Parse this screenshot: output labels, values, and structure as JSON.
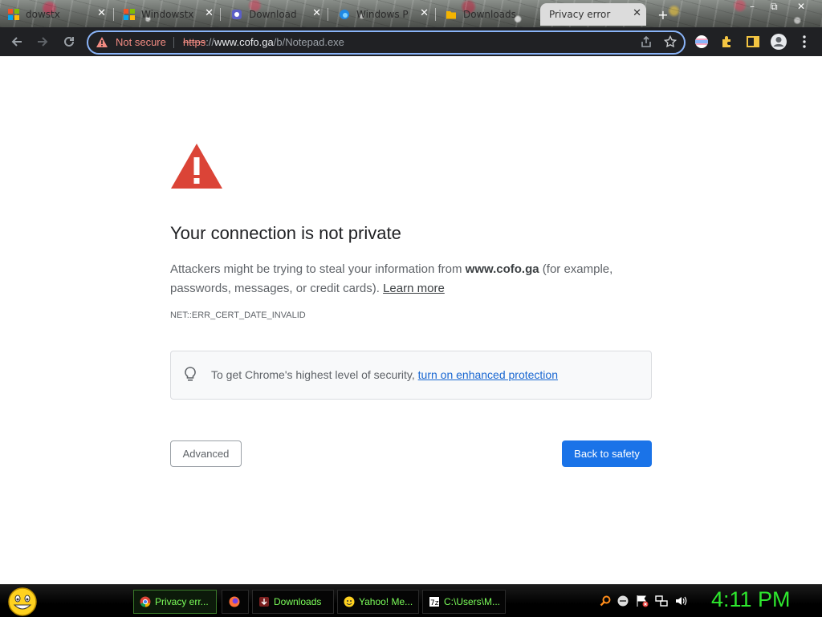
{
  "browser": {
    "tabs": [
      {
        "title": "dowstx",
        "favicon": "windows-logo-icon"
      },
      {
        "title": "Windowstx",
        "favicon": "windows-logo-icon"
      },
      {
        "title": "Download",
        "favicon": "app-icon"
      },
      {
        "title": "Windows P",
        "favicon": "edge-icon"
      },
      {
        "title": "Downloads",
        "favicon": "folder-icon"
      },
      {
        "title": "Privacy error",
        "favicon": "",
        "active": true
      }
    ],
    "new_tab": "+",
    "window_controls": [
      "–",
      "⧉",
      "✕"
    ]
  },
  "toolbar": {
    "not_secure_label": "Not secure",
    "url": {
      "scheme": "https",
      "separator": "://",
      "host": "www.cofo.ga",
      "path": "/b/Notepad.exe"
    },
    "icons": [
      "back-icon",
      "forward-icon",
      "reload-icon",
      "share-icon",
      "star-icon",
      "extension-icon",
      "puzzle-icon",
      "sidepanel-icon",
      "profile-icon",
      "menu-icon"
    ]
  },
  "page": {
    "heading": "Your connection is not private",
    "description_before": "Attackers might be trying to steal your information from ",
    "description_host": "www.cofo.ga",
    "description_after": " (for example, passwords, messages, or credit cards). ",
    "learn_more": "Learn more",
    "error_code": "NET::ERR_CERT_DATE_INVALID",
    "tip_text": "To get Chrome's highest level of security, ",
    "tip_link": "turn on enhanced protection",
    "advanced_button": "Advanced",
    "back_button": "Back to safety",
    "colors": {
      "warning_red": "#db4437",
      "link_blue": "#1967d2",
      "button_blue": "#1a73e8"
    }
  },
  "taskbar": {
    "items": [
      {
        "label": "Privacy err...",
        "icon": "chrome-icon",
        "active": true
      },
      {
        "label": "",
        "icon": "firefox-icon"
      },
      {
        "label": "Downloads",
        "icon": "downloads-icon"
      },
      {
        "label": "Yahoo! Me...",
        "icon": "yahoo-messenger-icon"
      },
      {
        "label": "C:\\Users\\M...",
        "icon": "7zip-icon"
      }
    ],
    "clock": "4:11 PM",
    "tray_icons": [
      "search-icon",
      "minus-circle-icon",
      "flag-icon",
      "network-icon",
      "volume-icon"
    ]
  }
}
